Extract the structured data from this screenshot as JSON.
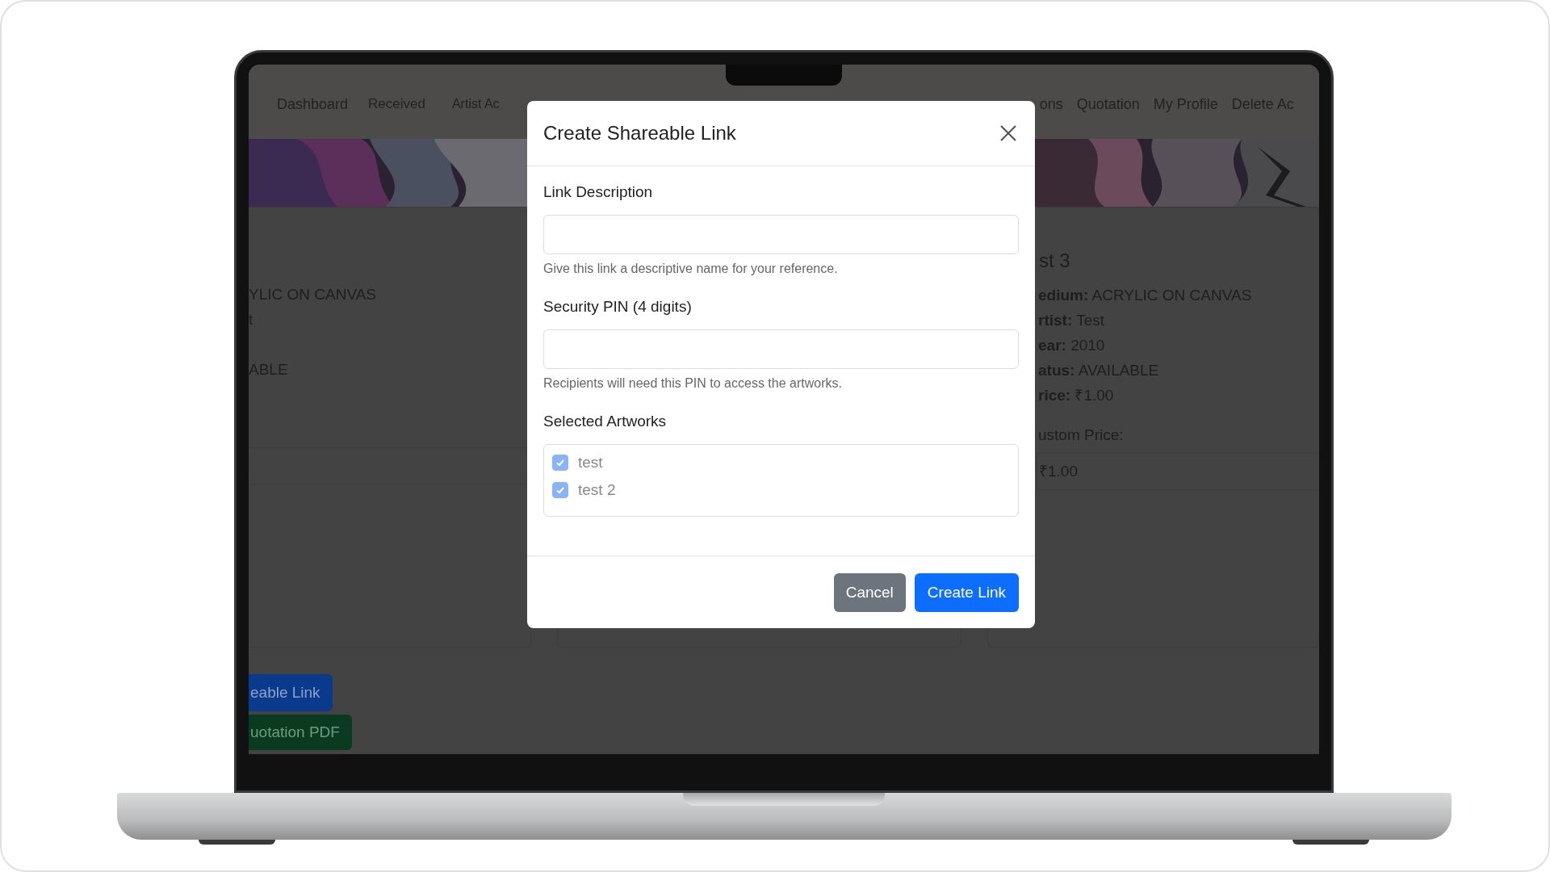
{
  "nav": {
    "items": [
      {
        "label": "Dashboard"
      },
      {
        "label": "Received"
      },
      {
        "label": "Artist Ac"
      },
      {
        "label": "ons"
      },
      {
        "label": "Quotation"
      },
      {
        "label": "My Profile"
      },
      {
        "label": "Delete Ac"
      }
    ]
  },
  "cards": [
    {
      "details": [
        {
          "kind": "line",
          "value": "YLIC ON CANVAS"
        },
        {
          "kind": "line",
          "value": "t"
        },
        {
          "kind": "blank"
        },
        {
          "kind": "line",
          "value": "ABLE"
        },
        {
          "kind": "blank"
        }
      ]
    },
    {
      "title": "st 3",
      "details": [
        {
          "kind": "line",
          "label": "edium:",
          "value": "ACRYLIC ON CANVAS"
        },
        {
          "kind": "line",
          "label": "rtist:",
          "value": "Test"
        },
        {
          "kind": "line",
          "label": "ear:",
          "value": "2010"
        },
        {
          "kind": "line",
          "label": "atus:",
          "value": "AVAILABLE"
        },
        {
          "kind": "line",
          "label": "rice:",
          "value": "₹1.00"
        }
      ],
      "custom_price_label": "ustom Price:",
      "custom_price": "₹1.00"
    }
  ],
  "page_buttons": [
    {
      "label": "eable Link",
      "kind": "primary"
    },
    {
      "label": "uotation PDF",
      "kind": "success"
    }
  ],
  "modal": {
    "title": "Create Shareable Link",
    "fields": [
      {
        "label": "Link Description",
        "help": "Give this link a descriptive name for your reference."
      },
      {
        "label": "Security PIN (4 digits)",
        "help": "Recipients will need this PIN to access the artworks."
      }
    ],
    "artworks_label": "Selected Artworks",
    "artworks": [
      {
        "name": "test",
        "checked": true
      },
      {
        "name": "test 2",
        "checked": true
      }
    ],
    "buttons": [
      {
        "label": "Cancel",
        "kind": "secondary"
      },
      {
        "label": "Create Link",
        "kind": "primary"
      }
    ]
  }
}
